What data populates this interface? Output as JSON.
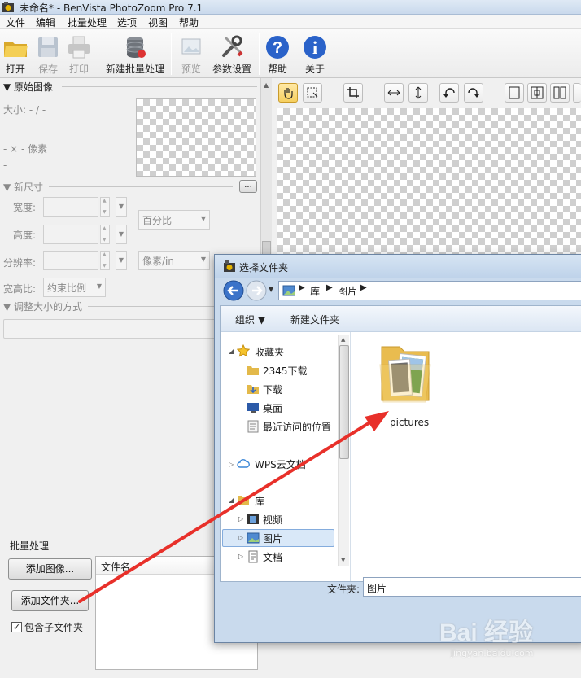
{
  "window": {
    "title": "未命名* - BenVista PhotoZoom Pro 7.1"
  },
  "menu": [
    "文件",
    "编辑",
    "批量处理",
    "选项",
    "视图",
    "帮助"
  ],
  "toolbar": {
    "open": "打开",
    "save": "保存",
    "print": "打印",
    "new_batch": "新建批量处理",
    "preview": "预览",
    "settings": "参数设置",
    "help": "帮助",
    "about": "关于"
  },
  "left_panel": {
    "original": {
      "header": "▼ 原始图像",
      "size": "大小: - / -",
      "dims": "- × - 像素",
      "dash": "-"
    },
    "new_size": {
      "header": "▼ 新尺寸",
      "more": "...",
      "width_label": "宽度:",
      "height_label": "高度:",
      "resolution_label": "分辨率:",
      "aspect_label": "宽高比:",
      "unit_value": "百分比",
      "res_unit_value": "像素/in",
      "aspect_value": "约束比例"
    },
    "resize_method": {
      "header": "▼ 调整大小的方式"
    }
  },
  "batch": {
    "header": "批量处理",
    "add_image": "添加图像...",
    "add_folder": "添加文件夹...",
    "include_subfolders": "包含子文件夹",
    "include_subfolders_checked": true,
    "column_filename": "文件名"
  },
  "dialog": {
    "title": "选择文件夹",
    "breadcrumb": [
      "库",
      "图片"
    ],
    "organize": "组织 ▼",
    "new_folder": "新建文件夹",
    "nav": {
      "favorites": "收藏夹",
      "fav_items": [
        "2345下载",
        "下载",
        "桌面",
        "最近访问的位置"
      ],
      "wps": "WPS云文档",
      "library": "库",
      "lib_items": [
        "视频",
        "图片",
        "文档"
      ]
    },
    "folder_item": "pictures",
    "folder_label": "文件夹:",
    "folder_value": "图片"
  },
  "watermark": {
    "text": "Bai 经验",
    "sub": "jingyan.baidu.com"
  },
  "colors": {
    "arrow": "#e8302a",
    "selection": "#cce4f7",
    "dialog_frame": "#c9daed"
  }
}
